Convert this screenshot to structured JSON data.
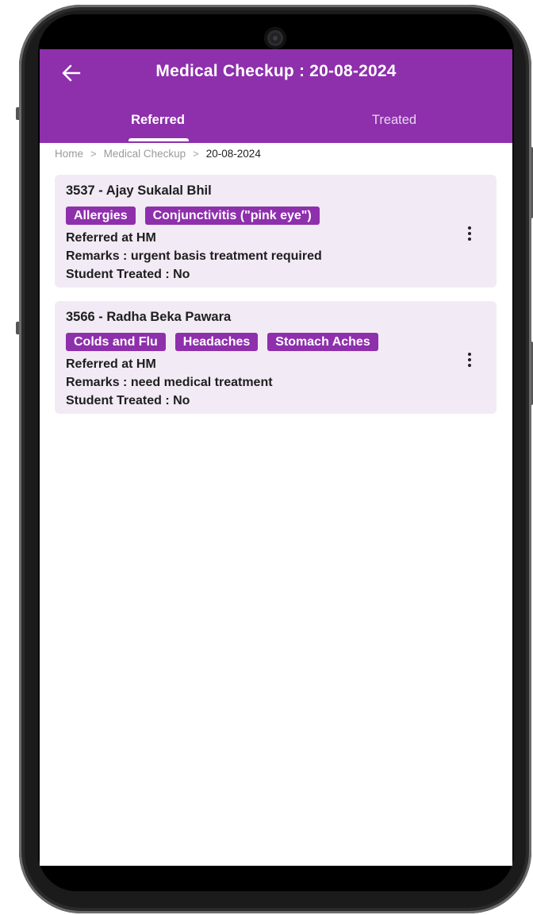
{
  "header": {
    "title": "Medical Checkup : 20-08-2024",
    "back_icon": "arrow-left-icon"
  },
  "tabs": [
    {
      "label": "Referred",
      "active": true
    },
    {
      "label": "Treated",
      "active": false
    }
  ],
  "breadcrumb": [
    "Home",
    "Medical Checkup",
    "20-08-2024"
  ],
  "colors": {
    "accent": "#8e2fac",
    "card_bg": "#f2eaf5"
  },
  "cards": [
    {
      "student": "3537 - Ajay Sukalal Bhil",
      "tags": [
        "Allergies",
        "Conjunctivitis (\"pink eye\")"
      ],
      "referred_at": "Referred at HM",
      "remarks": "Remarks  :  urgent basis treatment required",
      "treated": "Student Treated  :  No",
      "menu_icon": "more-vertical-icon"
    },
    {
      "student": "3566 - Radha Beka Pawara",
      "tags": [
        "Colds and Flu",
        "Headaches",
        "Stomach Aches"
      ],
      "referred_at": "Referred at HM",
      "remarks": "Remarks  :  need medical treatment",
      "treated": "Student Treated  :  No",
      "menu_icon": "more-vertical-icon"
    }
  ]
}
